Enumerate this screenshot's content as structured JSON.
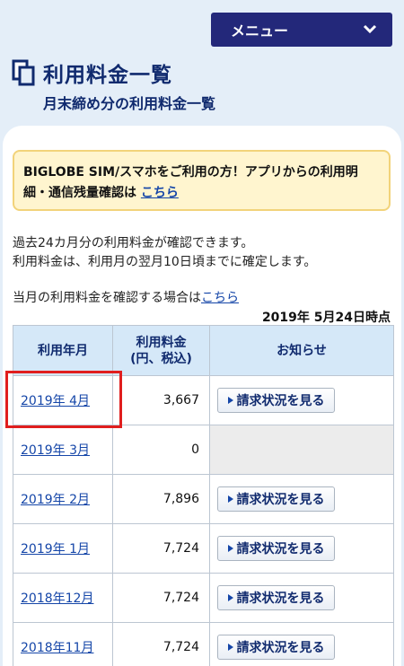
{
  "header": {
    "menu_label": "メニュー",
    "menu_icon": "chevron-down-icon"
  },
  "page": {
    "title": "利用料金一覧",
    "subtitle": "月末締め分の利用料金一覧",
    "title_icon": "document-copy-icon"
  },
  "notice": {
    "text": "BIGLOBE SIM/スマホをご利用の方！アプリからの利用明細・通信残量確認は ",
    "link": "こちら"
  },
  "intro": {
    "line1": "過去24カ月分の利用料金が確認できます。",
    "line2": "利用料金は、利用月の翌月10日頃までに確定します。"
  },
  "current_month": {
    "text": "当月の利用料金を確認する場合は",
    "link": "こちら"
  },
  "as_of": "2019年 5月24日時点",
  "table": {
    "headers": {
      "month": "利用年月",
      "amount_line1": "利用料金",
      "amount_line2": "(円、税込)",
      "notice": "お知らせ"
    },
    "button_label": "請求状況を見る",
    "rows": [
      {
        "month": "2019年 4月",
        "amount": "3,667",
        "has_button": true
      },
      {
        "month": "2019年 3月",
        "amount": "0",
        "has_button": false
      },
      {
        "month": "2019年 2月",
        "amount": "7,896",
        "has_button": true
      },
      {
        "month": "2019年 1月",
        "amount": "7,724",
        "has_button": true
      },
      {
        "month": "2018年12月",
        "amount": "7,724",
        "has_button": true
      },
      {
        "month": "2018年11月",
        "amount": "7,724",
        "has_button": true
      }
    ]
  },
  "colors": {
    "page_bg": "#e4eef8",
    "menu_bg": "#23287a",
    "title": "#102a6e",
    "link": "#1546a8",
    "notice_bg": "#fff5cf",
    "notice_border": "#f2d37a",
    "table_header_bg": "#d5e8f8",
    "highlight": "#e01e1e"
  }
}
